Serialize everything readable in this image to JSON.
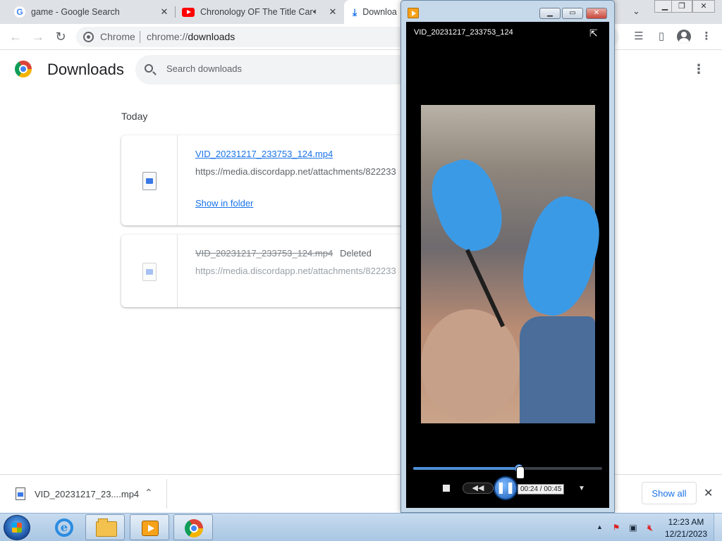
{
  "browser": {
    "tabs": [
      {
        "title": "game - Google Search",
        "icon": "google-icon"
      },
      {
        "title": "Chronology OF The Title Can",
        "icon": "youtube-icon",
        "audio": true
      },
      {
        "title": "Downloa",
        "icon": "download-icon",
        "active": true
      }
    ],
    "omnibox": {
      "chip": "Chrome",
      "url_scheme": "chrome://",
      "url_path": "downloads"
    },
    "window_controls": [
      "minimize",
      "restore",
      "close"
    ]
  },
  "downloads_page": {
    "title": "Downloads",
    "search_placeholder": "Search downloads",
    "date_header": "Today",
    "items": [
      {
        "filename": "VID_20231217_233753_124.mp4",
        "url": "https://media.discordapp.net/attachments/822233",
        "action": "Show in folder",
        "deleted": false
      },
      {
        "filename": "VID_20231217_233753_124.mp4",
        "url": "https://media.discordapp.net/attachments/822233",
        "status": "Deleted",
        "deleted": true
      }
    ]
  },
  "shelf": {
    "filename": "VID_20231217_23....mp4",
    "show_all": "Show all"
  },
  "player": {
    "filename": "VID_20231217_233753_124",
    "time_current": "00:24",
    "time_total": "00:45",
    "time_display": "00:24 / 00:45",
    "progress_fraction": 0.56,
    "state": "playing"
  },
  "taskbar": {
    "apps": [
      "internet-explorer",
      "file-explorer",
      "media-player",
      "chrome"
    ],
    "clock_time": "12:23 AM",
    "clock_date": "12/21/2023"
  },
  "colors": {
    "link": "#1a73e8",
    "tab_strip": "#dee1e6",
    "taskbar": "#a9c6e3",
    "player_accent": "#4d8fd6"
  }
}
